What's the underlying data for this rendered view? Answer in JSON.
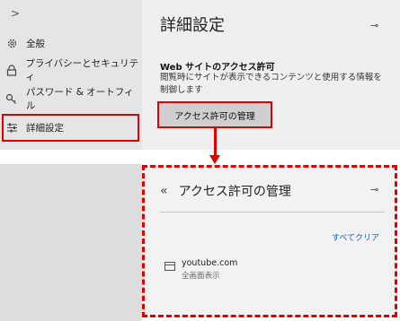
{
  "sidebar": {
    "expand_glyph": ">",
    "items": [
      {
        "label": "全般",
        "icon": "gear-icon"
      },
      {
        "label": "プライバシーとセキュリティ",
        "icon": "lock-icon"
      },
      {
        "label": "パスワード & オートフィル",
        "icon": "key-icon"
      },
      {
        "label": "詳細設定",
        "icon": "sliders-icon",
        "selected": true
      }
    ]
  },
  "advanced": {
    "title": "詳細設定",
    "pin_glyph": "⊸",
    "section_title": "Web サイトのアクセス許可",
    "section_desc": "閲覧時にサイトが表示できるコンテンツと使用する情報を制御します",
    "manage_button": "アクセス許可の管理"
  },
  "permissions": {
    "back_glyph": "«",
    "title": "アクセス許可の管理",
    "pin_glyph": "⊸",
    "clear_all": "すべてクリア",
    "sites": [
      {
        "name": "youtube.com",
        "permission": "全画面表示",
        "icon": "window-icon"
      }
    ]
  },
  "colors": {
    "highlight": "#e00000",
    "link": "#1a5fb4"
  }
}
